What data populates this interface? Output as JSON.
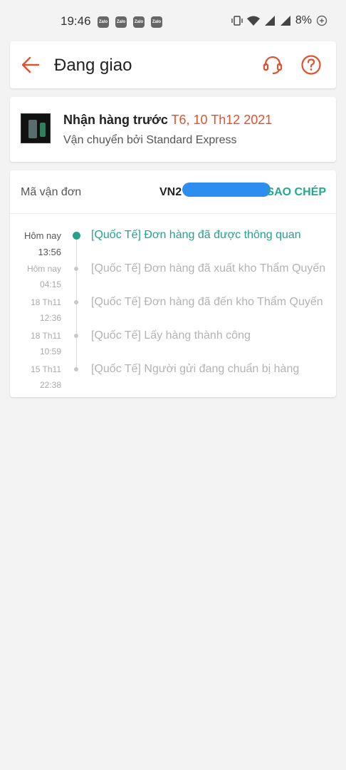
{
  "status_bar": {
    "time": "19:46",
    "notifications": [
      "Zalo",
      "Zalo",
      "Zalo",
      "Zalo"
    ],
    "battery": "8%"
  },
  "header": {
    "title": "Đang giao",
    "back_icon": "arrow-left-icon",
    "support_icon": "headset-icon",
    "help_icon": "question-circle-icon"
  },
  "delivery": {
    "label": "Nhận hàng trước",
    "date": "T6, 10 Th12 2021",
    "carrier": "Vận chuyển bởi Standard Express"
  },
  "tracking": {
    "code_label": "Mã vận đơn",
    "code_value": "VN2",
    "copy_label": "SAO CHÉP",
    "events": [
      {
        "day": "Hôm nay",
        "time": "13:56",
        "text": "[Quốc Tế] Đơn hàng đã được thông quan",
        "active": true
      },
      {
        "day": "Hôm nay",
        "time": "04:15",
        "text": "[Quốc Tế] Đơn hàng đã xuất kho Thẩm Quyến",
        "active": false
      },
      {
        "day": "18 Th11",
        "time": "12:36",
        "text": "[Quốc Tế] Đơn hàng đã đến kho Thẩm Quyến",
        "active": false
      },
      {
        "day": "18 Th11",
        "time": "10:59",
        "text": "[Quốc Tế] Lấy hàng thành công",
        "active": false
      },
      {
        "day": "15 Th11",
        "time": "22:38",
        "text": "[Quốc Tế] Người gửi đang chuẩn bị hàng",
        "active": false
      }
    ]
  },
  "colors": {
    "accent": "#e0522e",
    "teal": "#27a08c"
  }
}
